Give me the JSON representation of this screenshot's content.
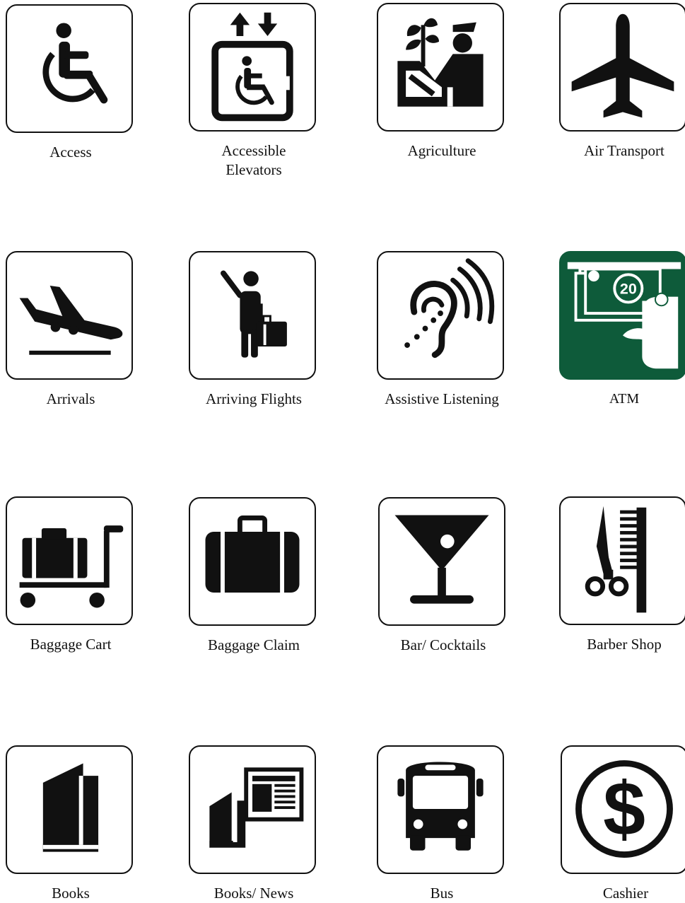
{
  "icons": [
    {
      "label": "Access",
      "icon": "wheelchair-icon"
    },
    {
      "label": "Accessible\nElevators",
      "icon": "accessible-elevator-icon"
    },
    {
      "label": "Agriculture",
      "icon": "agriculture-inspector-icon"
    },
    {
      "label": "Air Transport",
      "icon": "airplane-icon"
    },
    {
      "label": "Arrivals",
      "icon": "airplane-landing-icon"
    },
    {
      "label": "Arriving Flights",
      "icon": "traveler-waving-icon"
    },
    {
      "label": "Assistive Listening",
      "icon": "ear-sound-icon"
    },
    {
      "label": "ATM",
      "icon": "atm-cash-icon"
    },
    {
      "label": "Baggage Cart",
      "icon": "baggage-cart-icon"
    },
    {
      "label": "Baggage Claim",
      "icon": "suitcase-icon"
    },
    {
      "label": "Bar/ Cocktails",
      "icon": "cocktail-glass-icon"
    },
    {
      "label": "Barber Shop",
      "icon": "scissors-comb-icon"
    },
    {
      "label": "Books",
      "icon": "book-icon"
    },
    {
      "label": "Books/ News",
      "icon": "book-newspaper-icon"
    },
    {
      "label": "Bus",
      "icon": "bus-icon"
    },
    {
      "label": "Cashier",
      "icon": "dollar-sign-icon"
    }
  ],
  "colors": {
    "ink": "#111111",
    "atm_green": "#0e5b3a"
  }
}
